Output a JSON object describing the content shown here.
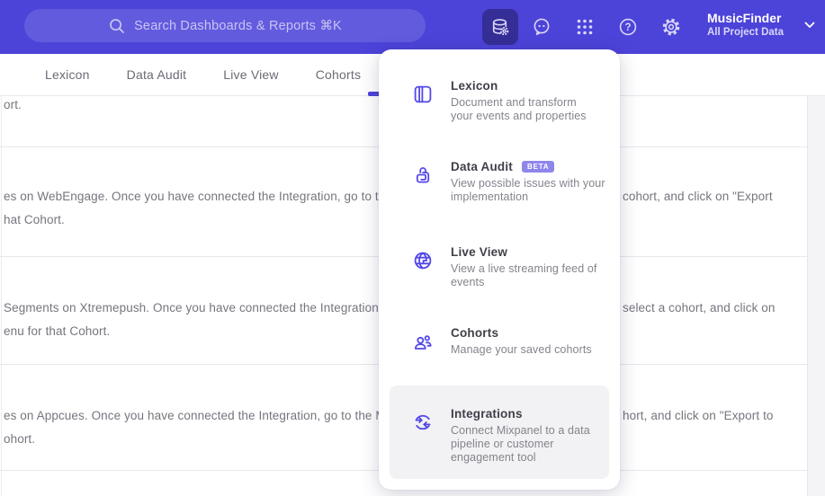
{
  "colors": {
    "header_bg": "#4C43D9",
    "accent": "#4C43D9",
    "active_tile_bg": "#352E96",
    "menu_icon": "#5348E8",
    "badge_bg": "#8F86EC",
    "menu_highlight_bg": "#F2F2F4"
  },
  "header": {
    "search_label": "Search Dashboards & Reports ⌘K",
    "project_name": "MusicFinder",
    "project_subtitle": "All Project Data",
    "help_glyph": "?"
  },
  "tabs": [
    {
      "label": "Lexicon"
    },
    {
      "label": "Data Audit"
    },
    {
      "label": "Live View"
    },
    {
      "label": "Cohorts"
    }
  ],
  "background_rows": [
    {
      "left": "ort."
    },
    {
      "line1_left": "es on WebEngage. Once you have connected the Integration, go to the",
      "line1_right": "cohort, and click on \"Export",
      "line2": "hat Cohort."
    },
    {
      "line1_left": "Segments on Xtremepush. Once you have connected the Integration,",
      "line1_right": "select a cohort, and click on",
      "line2": "enu for that Cohort."
    },
    {
      "line1_left": "es on Appcues. Once you have connected the Integration, go to the M",
      "line1_right": "hort, and click on \"Export to",
      "line2": "ohort."
    }
  ],
  "menu": {
    "items": [
      {
        "title": "Lexicon",
        "description": "Document and transform\nyour events and properties"
      },
      {
        "title": "Data Audit",
        "badge": "BETA",
        "description": "View possible issues with your\nimplementation"
      },
      {
        "title": "Live View",
        "description": "View a live streaming feed of\nevents"
      },
      {
        "title": "Cohorts",
        "description": "Manage your saved cohorts"
      },
      {
        "title": "Integrations",
        "description": "Connect Mixpanel to a data\npipeline or customer\nengagement tool"
      }
    ]
  }
}
